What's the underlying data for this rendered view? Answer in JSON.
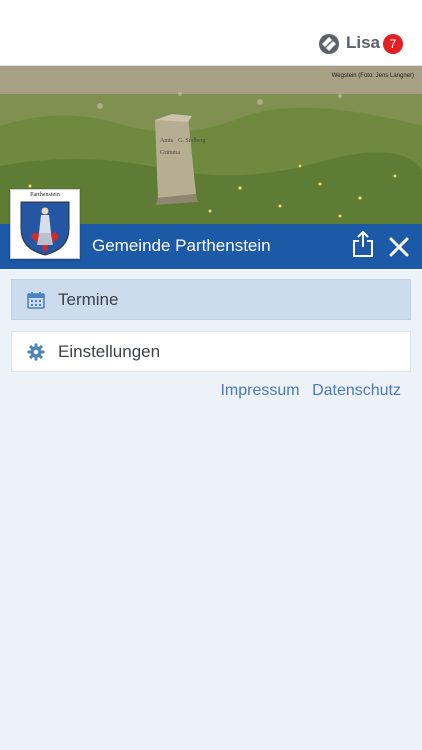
{
  "app": {
    "brand": "Lisa",
    "notification_count": "7",
    "brand_icon": "lisa-logo-icon"
  },
  "header": {
    "photo_credit": "Wegstein (Foto: Jens Langner)",
    "crest_name": "Parthenstein",
    "title": "Gemeinde Parthenstein",
    "share_icon": "share-icon",
    "close_icon": "close-icon"
  },
  "menu": {
    "items": [
      {
        "label": "Termine",
        "icon": "calendar-icon",
        "active": true
      },
      {
        "label": "Einstellungen",
        "icon": "gear-icon",
        "active": false
      }
    ]
  },
  "footer_links": {
    "impressum": "Impressum",
    "datenschutz": "Datenschutz"
  },
  "colors": {
    "accent": "#1c5aa8",
    "badge": "#e31e24",
    "active_item": "#cddcec",
    "background": "#edf1f8",
    "link": "#4a7ab8"
  }
}
